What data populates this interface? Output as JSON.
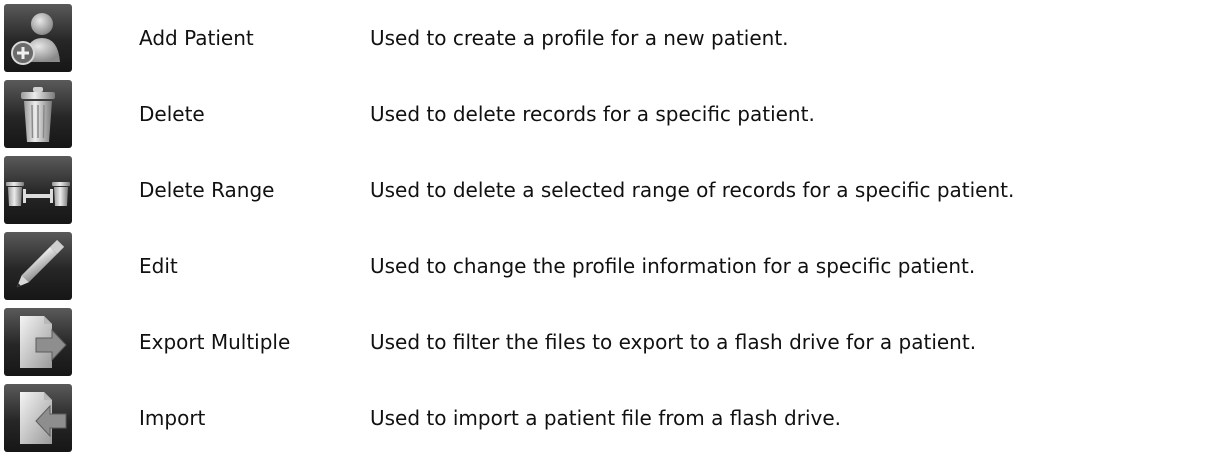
{
  "rows": [
    {
      "icon": "add-patient-icon",
      "name": "Add Patient",
      "description": "Used to create a profile for a new patient."
    },
    {
      "icon": "trash-can-icon",
      "name": "Delete",
      "description": "Used to delete records for a specific patient."
    },
    {
      "icon": "delete-range-icon",
      "name": "Delete Range",
      "description": "Used to delete a selected range of records for a specific patient."
    },
    {
      "icon": "pencil-icon",
      "name": "Edit",
      "description": "Used to change the profile information for a specific patient."
    },
    {
      "icon": "export-icon",
      "name": "Export Multiple",
      "description": "Used to filter the files to export to a flash drive for a patient."
    },
    {
      "icon": "import-icon",
      "name": "Import",
      "description": "Used to import a patient file from a flash drive."
    }
  ]
}
